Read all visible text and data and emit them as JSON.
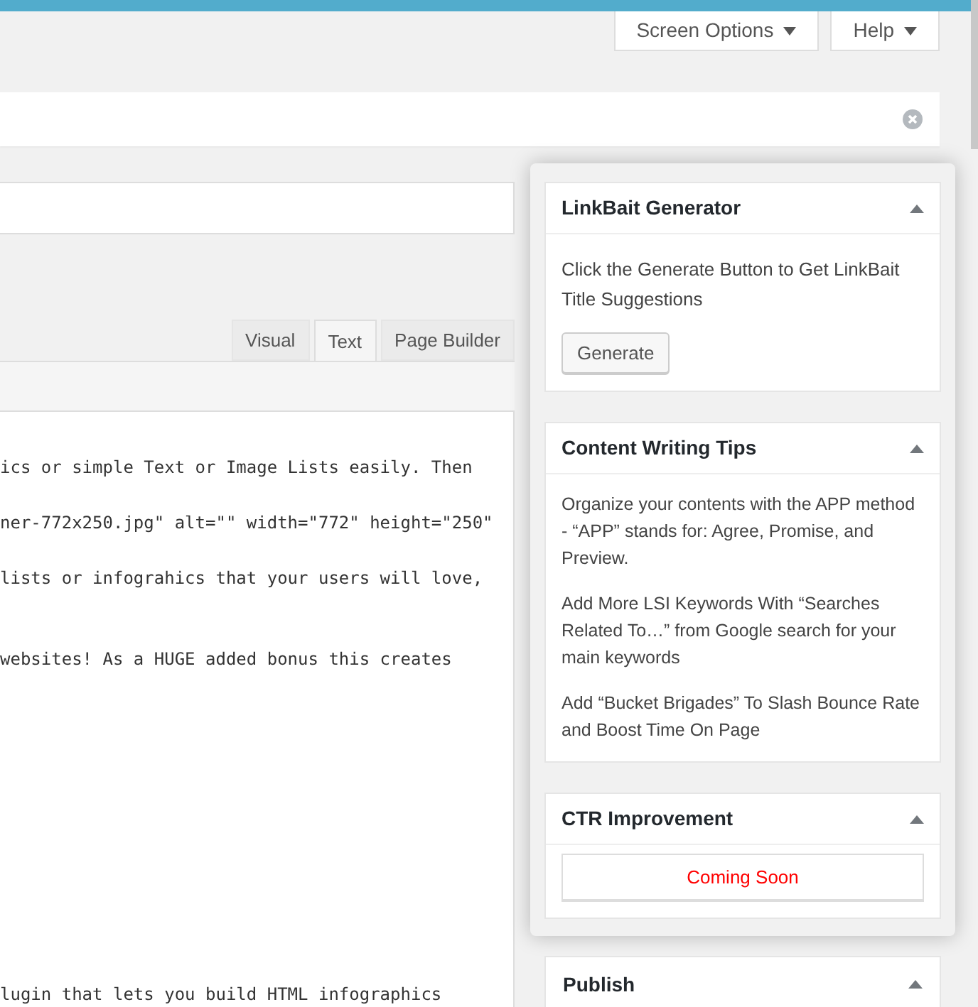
{
  "header_buttons": [
    {
      "label": "Screen Options"
    },
    {
      "label": "Help"
    }
  ],
  "editor": {
    "tabs": [
      {
        "label": "Visual",
        "selected": false
      },
      {
        "label": "Text",
        "selected": true
      },
      {
        "label": "Page Builder",
        "selected": false
      }
    ],
    "lines": [
      "ics or simple Text or Image Lists easily. Then",
      "ner-772x250.jpg\" alt=\"\" width=\"772\" height=\"250\"",
      "lists or infograhics that your users will love,",
      "websites! As a HUGE added bonus this creates"
    ],
    "bottom_line": "lugin that lets you build HTML infographics"
  },
  "panel": {
    "boxes": [
      {
        "kind": "generator",
        "title": "LinkBait Generator",
        "text": "Click the Generate Button to Get LinkBait Title Suggestions",
        "button": "Generate"
      },
      {
        "kind": "tips",
        "title": "Content Writing Tips",
        "tips": [
          "Organize your contents with the APP method - “APP” stands for: Agree, Promise, and Preview.",
          "Add More LSI Keywords With “Searches Related To…” from Google search for your main keywords",
          "Add “Bucket Brigades” To Slash Bounce Rate and Boost Time On Page"
        ]
      },
      {
        "kind": "notice",
        "title": "CTR Improvement",
        "notice": "Coming Soon"
      }
    ]
  },
  "publish": {
    "title": "Publish"
  }
}
